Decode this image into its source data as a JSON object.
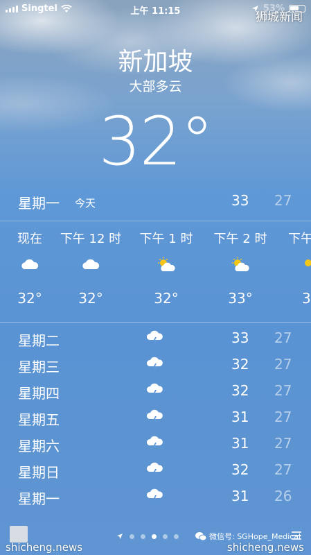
{
  "status_bar": {
    "carrier": "Singtel",
    "time": "上午 11:15",
    "battery": "53%"
  },
  "watermark_top": "狮城新闻",
  "weather": {
    "city": "新加坡",
    "condition": "大部多云",
    "temperature": "32°"
  },
  "today": {
    "day": "星期一",
    "label": "今天",
    "high": "33",
    "low": "27"
  },
  "hourly": [
    {
      "label": "现在",
      "icon": "cloud-icon",
      "temp": "32°"
    },
    {
      "label": "下午 12 时",
      "icon": "cloud-icon",
      "temp": "32°"
    },
    {
      "label": "下午 1 时",
      "icon": "partly-sunny-icon",
      "temp": "32°"
    },
    {
      "label": "下午 2 时",
      "icon": "partly-sunny-icon",
      "temp": "33°"
    },
    {
      "label": "下午",
      "icon": "partly-sunny-icon",
      "temp": "3"
    }
  ],
  "daily": [
    {
      "day": "星期二",
      "icon": "thunderstorm-icon",
      "high": "33",
      "low": "27"
    },
    {
      "day": "星期三",
      "icon": "thunderstorm-icon",
      "high": "32",
      "low": "27"
    },
    {
      "day": "星期四",
      "icon": "thunderstorm-icon",
      "high": "32",
      "low": "27"
    },
    {
      "day": "星期五",
      "icon": "thunderstorm-icon",
      "high": "31",
      "low": "27"
    },
    {
      "day": "星期六",
      "icon": "thunderstorm-icon",
      "high": "31",
      "low": "27"
    },
    {
      "day": "星期日",
      "icon": "thunderstorm-icon",
      "high": "32",
      "low": "27"
    },
    {
      "day": "星期一",
      "icon": "thunderstorm-icon",
      "high": "31",
      "low": "26"
    }
  ],
  "bottom": {
    "watermark_left": "shicheng.news",
    "watermark_right": "shicheng.news",
    "wechat": "微信号: SGHope_Medical"
  },
  "colors": {
    "sky_top": "#8aa3bd",
    "sky": "#5f98d6",
    "text": "#ffffff"
  }
}
